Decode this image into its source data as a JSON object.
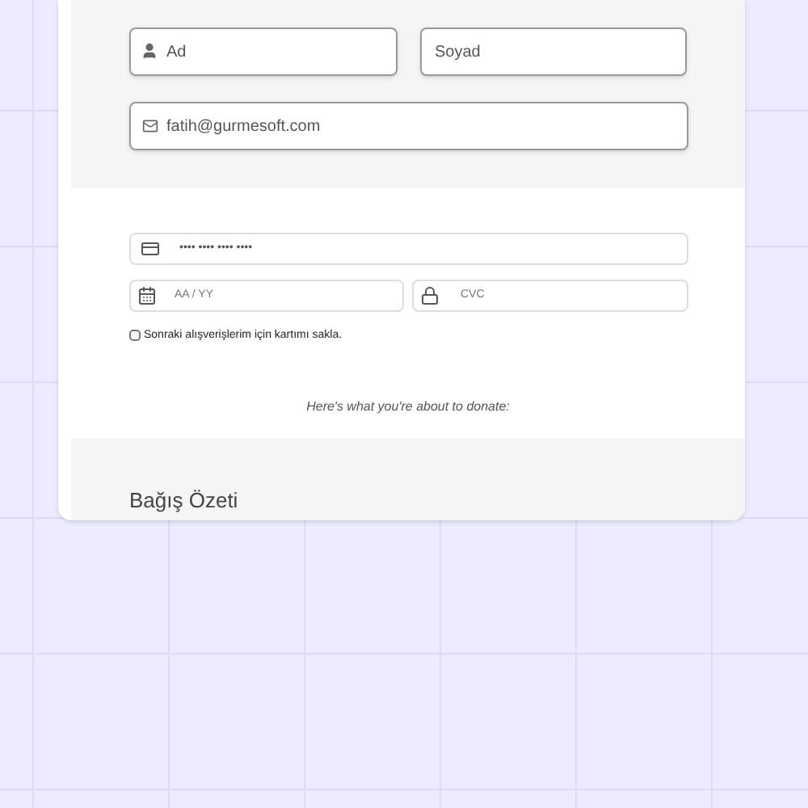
{
  "contact": {
    "first_name": {
      "placeholder": "Ad"
    },
    "last_name": {
      "placeholder": "Soyad"
    },
    "email": {
      "value": "fatih@gurmesoft.com"
    }
  },
  "payment": {
    "card_number": {
      "placeholder": "•••• •••• •••• ••••"
    },
    "expiry": {
      "placeholder": "AA / YY"
    },
    "cvc": {
      "placeholder": "CVC"
    },
    "save_card": {
      "label": "Sonraki alışverişlerim için kartımı sakla.",
      "checked": false
    },
    "note": "Here's what you're about to donate:"
  },
  "summary": {
    "title": "Bağış Özeti"
  }
}
